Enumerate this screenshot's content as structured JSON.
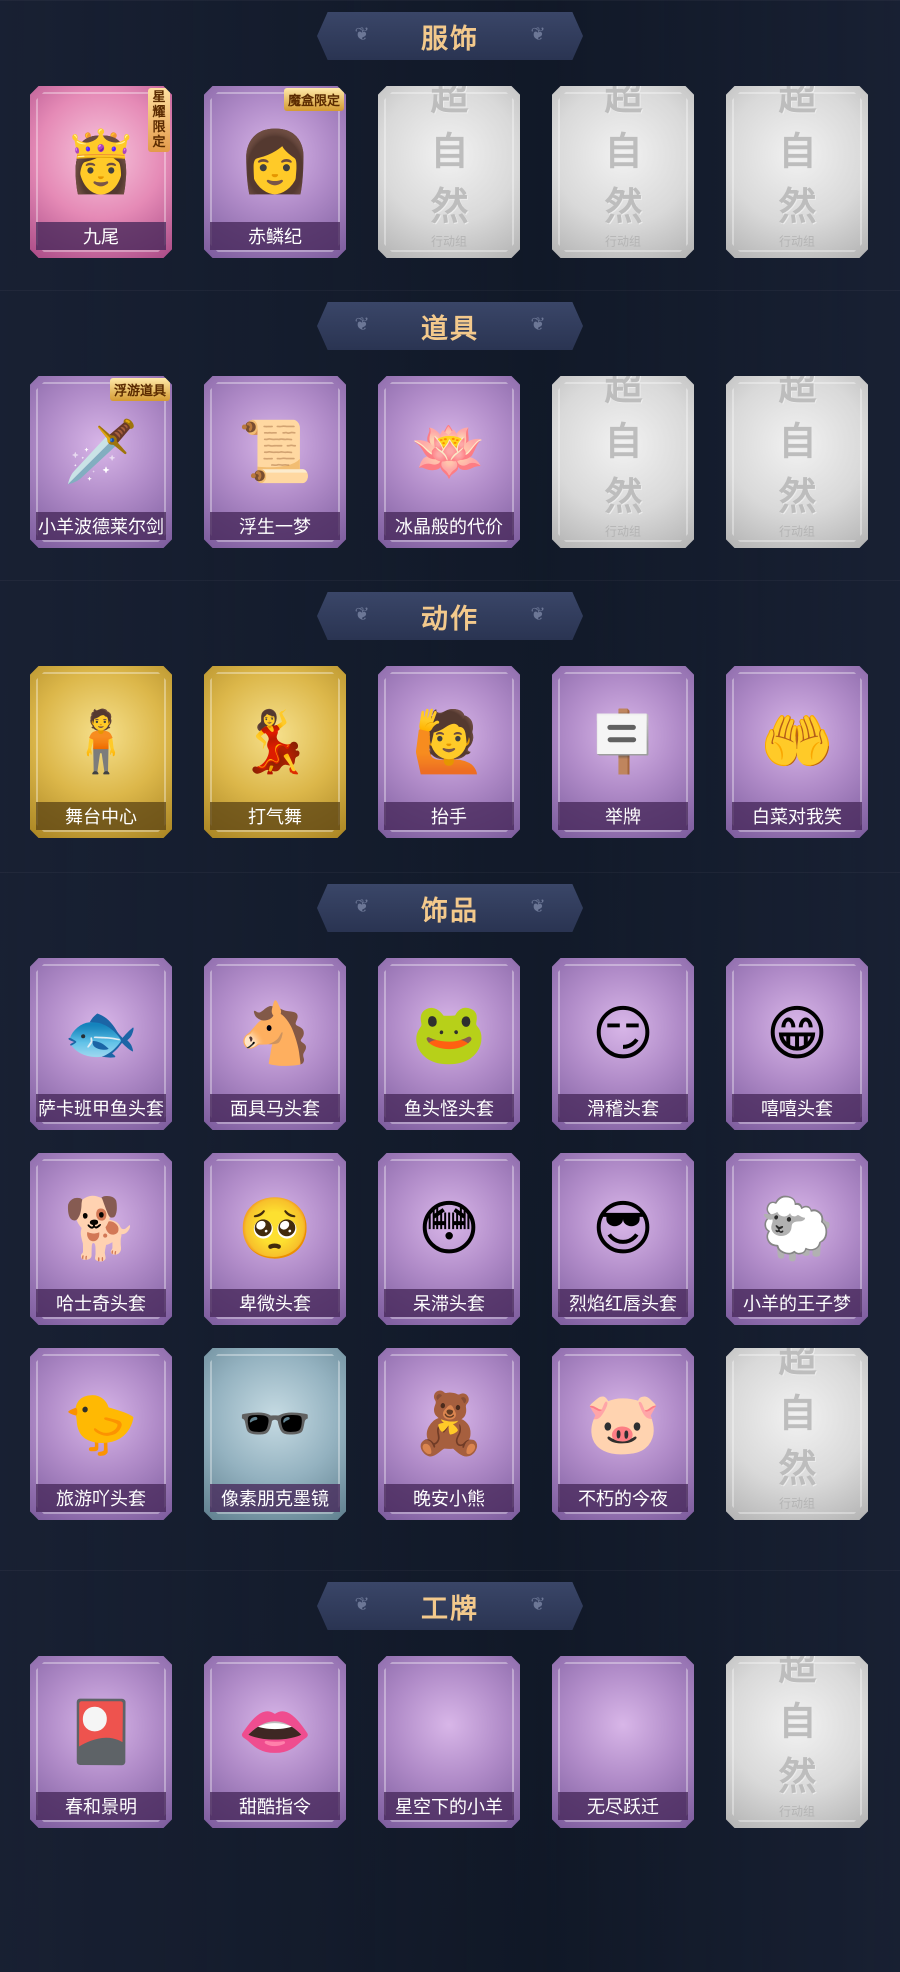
{
  "placeholder": {
    "main": "超自然",
    "sub": "行动组"
  },
  "sections": [
    {
      "title": "服饰",
      "items": [
        {
          "label": "九尾",
          "variant": "pink",
          "icon": "fox-girl-portrait",
          "glyph": "👸",
          "badge": "星耀限定",
          "badge_style": "vertical"
        },
        {
          "label": "赤鳞纪",
          "variant": "purple",
          "icon": "dragon-girl-portrait",
          "glyph": "👩",
          "badge": "魔盒限定",
          "badge_style": "horizontal"
        },
        {
          "label": "",
          "variant": "grey",
          "icon": "locked-placeholder"
        },
        {
          "label": "",
          "variant": "grey",
          "icon": "locked-placeholder"
        },
        {
          "label": "",
          "variant": "grey",
          "icon": "locked-placeholder"
        }
      ]
    },
    {
      "title": "道具",
      "items": [
        {
          "label": "小羊波德莱尔剑",
          "variant": "purple",
          "icon": "sword",
          "glyph": "🗡️",
          "badge": "浮游道具",
          "badge_style": "horizontal"
        },
        {
          "label": "浮生一梦",
          "variant": "purple",
          "icon": "scroll",
          "glyph": "📜"
        },
        {
          "label": "冰晶般的代价",
          "variant": "purple",
          "icon": "ice-lotus",
          "glyph": "🪷"
        },
        {
          "label": "",
          "variant": "grey",
          "icon": "locked-placeholder"
        },
        {
          "label": "",
          "variant": "grey",
          "icon": "locked-placeholder"
        }
      ]
    },
    {
      "title": "动作",
      "items": [
        {
          "label": "舞台中心",
          "variant": "gold",
          "icon": "pose-silhouette",
          "glyph": "🧍"
        },
        {
          "label": "打气舞",
          "variant": "gold",
          "icon": "dance-silhouette",
          "glyph": "💃"
        },
        {
          "label": "抬手",
          "variant": "purple",
          "icon": "hand-raise",
          "glyph": "🙋"
        },
        {
          "label": "举牌",
          "variant": "purple",
          "icon": "hold-sign",
          "glyph": "🪧"
        },
        {
          "label": "白菜对我笑",
          "variant": "purple",
          "icon": "cabbage-pose",
          "glyph": "🤲"
        }
      ]
    },
    {
      "title": "饰品",
      "items": [
        {
          "label": "萨卡班甲鱼头套",
          "variant": "purple",
          "icon": "fish-head",
          "glyph": "🐟"
        },
        {
          "label": "面具马头套",
          "variant": "purple",
          "icon": "horse-head",
          "glyph": "🐴"
        },
        {
          "label": "鱼头怪头套",
          "variant": "purple",
          "icon": "fish-monster-head",
          "glyph": "🐸"
        },
        {
          "label": "滑稽头套",
          "variant": "purple",
          "icon": "funny-face",
          "glyph": "😏"
        },
        {
          "label": "嘻嘻头套",
          "variant": "purple",
          "icon": "grin-face",
          "glyph": "😁"
        },
        {
          "label": "哈士奇头套",
          "variant": "purple",
          "icon": "husky-head",
          "glyph": "🐕"
        },
        {
          "label": "卑微头套",
          "variant": "purple",
          "icon": "humble-face",
          "glyph": "🥺"
        },
        {
          "label": "呆滞头套",
          "variant": "purple",
          "icon": "dazed-face",
          "glyph": "😳"
        },
        {
          "label": "烈焰红唇头套",
          "variant": "purple",
          "icon": "red-lips-head",
          "glyph": "😎"
        },
        {
          "label": "小羊的王子梦",
          "variant": "purple",
          "icon": "sheep-crown",
          "glyph": "🐑"
        },
        {
          "label": "旅游吖头套",
          "variant": "purple",
          "icon": "tourist-duck",
          "glyph": "🐤"
        },
        {
          "label": "像素朋克墨镜",
          "variant": "teal",
          "icon": "pixel-sunglasses",
          "glyph": "🕶️"
        },
        {
          "label": "晚安小熊",
          "variant": "purple",
          "icon": "bear-charm",
          "glyph": "🧸"
        },
        {
          "label": "不朽的今夜",
          "variant": "purple",
          "icon": "pig-bowl",
          "glyph": "🐷"
        },
        {
          "label": "",
          "variant": "grey",
          "icon": "locked-placeholder"
        }
      ]
    },
    {
      "title": "工牌",
      "items": [
        {
          "label": "春和景明",
          "variant": "purple",
          "icon": "gold-card",
          "glyph": "🎴"
        },
        {
          "label": "甜酷指令",
          "variant": "purple",
          "icon": "pink-monster",
          "glyph": "👄"
        },
        {
          "label": "星空下的小羊",
          "variant": "purple",
          "icon": "blank",
          "glyph": ""
        },
        {
          "label": "无尽跃迁",
          "variant": "purple",
          "icon": "blank",
          "glyph": ""
        },
        {
          "label": "",
          "variant": "grey",
          "icon": "locked-placeholder"
        }
      ]
    }
  ]
}
